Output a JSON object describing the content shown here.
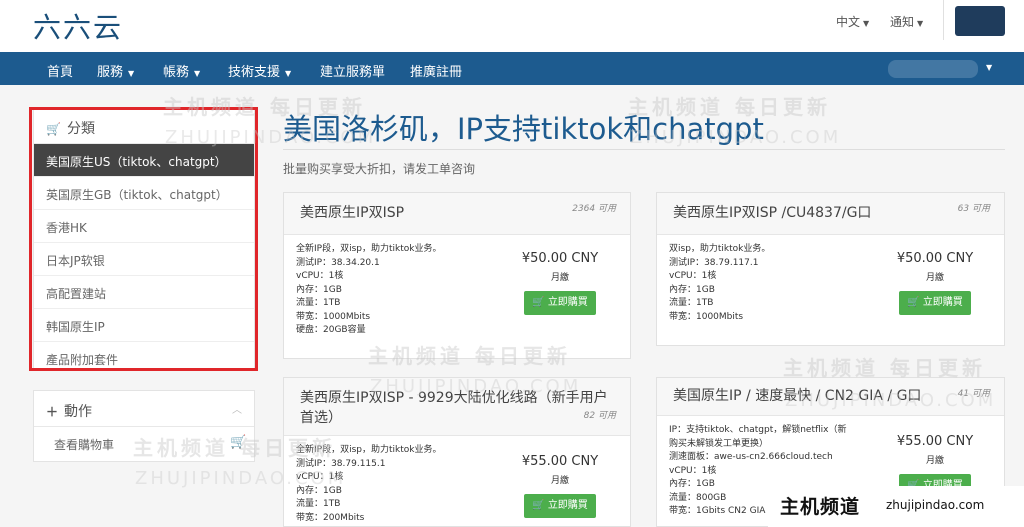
{
  "header": {
    "logo": "六六云",
    "language": "中文",
    "notifications": "通知"
  },
  "nav": {
    "items": [
      "首頁",
      "服務",
      "帳務",
      "技術支援",
      "建立服務單",
      "推廣註冊"
    ]
  },
  "sidebar": {
    "categories_title": "分類",
    "categories": [
      "美国原生US（tiktok、chatgpt）",
      "英国原生GB（tiktok、chatgpt）",
      "香港HK",
      "日本JP软银",
      "高配置建站",
      "韩国原生IP",
      "產品附加套件"
    ],
    "actions_title": "動作",
    "actions": [
      "查看購物車"
    ]
  },
  "main": {
    "title": "美国洛杉矶，IP支持tiktok和chatgpt",
    "subtitle": "批量购买享受大折扣，请发工单咨询"
  },
  "products": [
    {
      "name": "美西原生IP双ISP",
      "qty": "2364 可用",
      "specs": [
        "全新IP段，双isp，助力tiktok业务。",
        "测试IP：38.34.20.1",
        "vCPU：1核",
        "內存：1GB",
        "流量：1TB",
        "带宽：1000Mbits",
        "硬盘：20GB容量"
      ],
      "price": "¥50.00 CNY",
      "cycle": "月繳",
      "buy": "立即購買"
    },
    {
      "name": "美西原生IP双ISP /CU4837/G口",
      "qty": "63 可用",
      "specs": [
        "双isp，助力tiktok业务。",
        "测试IP：38.79.117.1",
        "vCPU：1核",
        "內存：1GB",
        "流量：1TB",
        "带宽：1000Mbits"
      ],
      "price": "¥50.00 CNY",
      "cycle": "月繳",
      "buy": "立即購買"
    },
    {
      "name": "美西原生IP双ISP - 9929大陆优化线路（新手用户首选）",
      "qty": "82 可用",
      "specs": [
        "全新IP段，双isp，助力tiktok业务。",
        "测试IP：38.79.115.1",
        "vCPU：1核",
        "內存：1GB",
        "流量：1TB",
        "带宽：200Mbits"
      ],
      "price": "¥55.00 CNY",
      "cycle": "月繳",
      "buy": "立即購買"
    },
    {
      "name": "美国原生IP / 速度最快 / CN2 GIA / G口",
      "qty": "41 可用",
      "specs": [
        "IP：支持tiktok、chatgpt，解锁netflix（新",
        "购买未解锁发工单更换）",
        "测速面板：awe-us-cn2.666cloud.tech",
        "vCPU：1核",
        "內存：1GB",
        "流量：800GB",
        "带宽：1Gbits CN2 GIA"
      ],
      "price": "¥55.00 CNY",
      "cycle": "月繳",
      "buy": "立即購買"
    }
  ],
  "watermark": {
    "cn": "主机频道 每日更新",
    "en": "ZHUJIPINDAO.COM",
    "corner_cn": "主机频道",
    "corner_en": "zhujipindao.com"
  }
}
